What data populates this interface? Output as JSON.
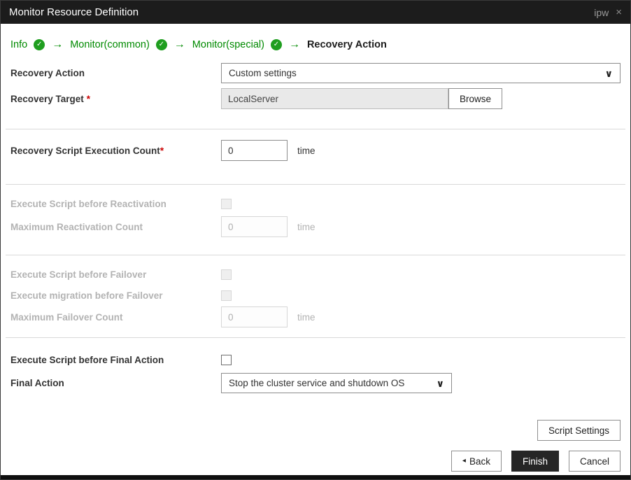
{
  "titlebar": {
    "title": "Monitor Resource Definition",
    "context_label": "ipw",
    "close_glyph": "×"
  },
  "wizard": {
    "arrow_glyph": "→",
    "check_glyph": "✓",
    "steps": [
      {
        "label": "Info",
        "status": "complete"
      },
      {
        "label": "Monitor(common)",
        "status": "complete"
      },
      {
        "label": "Monitor(special)",
        "status": "complete"
      },
      {
        "label": "Recovery Action",
        "status": "current"
      }
    ]
  },
  "icons": {
    "chevron_down": "∨",
    "back_arrow": "◂"
  },
  "form": {
    "recovery_action": {
      "label": "Recovery Action",
      "value": "Custom settings"
    },
    "recovery_target": {
      "label": "Recovery Target",
      "required": "*",
      "value": "LocalServer",
      "browse": "Browse"
    },
    "script_execution_count": {
      "label": "Recovery Script Execution Count",
      "required": "*",
      "value": "0",
      "unit": "time"
    },
    "reactivation": {
      "execute_script_label": "Execute Script before Reactivation",
      "execute_script_checked": false,
      "max_count_label": "Maximum Reactivation Count",
      "max_count_value": "0",
      "unit": "time",
      "enabled": false
    },
    "failover": {
      "execute_script_label": "Execute Script before Failover",
      "execute_script_checked": false,
      "execute_migration_label": "Execute migration before Failover",
      "execute_migration_checked": false,
      "max_count_label": "Maximum Failover Count",
      "max_count_value": "0",
      "unit": "time",
      "enabled": false
    },
    "final": {
      "execute_script_label": "Execute Script before Final Action",
      "execute_script_checked": false,
      "action_label": "Final Action",
      "action_value": "Stop the cluster service and shutdown OS"
    }
  },
  "buttons": {
    "script_settings": "Script Settings",
    "back": "Back",
    "finish": "Finish",
    "cancel": "Cancel"
  },
  "colors": {
    "green_accent": "#008a00",
    "titlebar_bg": "#1c1c1c",
    "required_red": "#cc0000",
    "finish_button_bg": "#262626"
  }
}
